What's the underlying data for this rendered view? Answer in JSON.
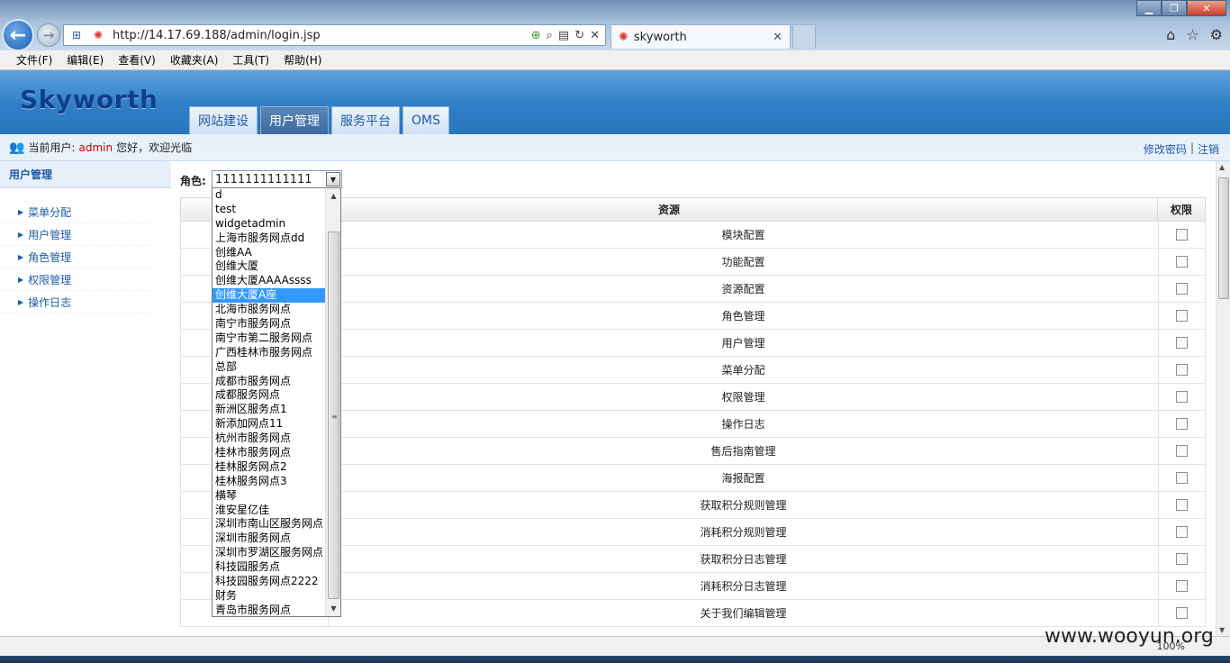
{
  "browser": {
    "url": "http://14.17.69.188/admin/login.jsp",
    "tab_title": "skyworth",
    "menu": [
      "文件(F)",
      "编辑(E)",
      "查看(V)",
      "收藏夹(A)",
      "工具(T)",
      "帮助(H)"
    ],
    "zoom": "100%"
  },
  "app": {
    "logo": "Skyworth",
    "nav_tabs": [
      "网站建设",
      "用户管理",
      "服务平台",
      "OMS"
    ],
    "active_tab": "用户管理"
  },
  "userbar": {
    "prefix": "当前用户:",
    "username": "admin",
    "greeting": "您好，欢迎光临",
    "change_password": "修改密码",
    "separator": "|",
    "logout": "注销"
  },
  "sidebar": {
    "title": "用户管理",
    "items": [
      "菜单分配",
      "用户管理",
      "角色管理",
      "权限管理",
      "操作日志"
    ]
  },
  "main": {
    "role_label": "角色:",
    "role_value": "1111111111111",
    "columns": {
      "resource": "资源",
      "permission": "权限"
    },
    "rows": [
      "模块配置",
      "功能配置",
      "资源配置",
      "角色管理",
      "用户管理",
      "菜单分配",
      "权限管理",
      "操作日志",
      "售后指南管理",
      "海报配置",
      "获取积分规则管理",
      "消耗积分规则管理",
      "获取积分日志管理",
      "消耗积分日志管理",
      "关于我们编辑管理"
    ]
  },
  "dropdown": {
    "selected": "创维大厦A座",
    "options": [
      "d",
      "test",
      "widgetadmin",
      "上海市服务网点dd",
      "创维AA",
      "创维大厦",
      "创维大厦AAAAssss",
      "创维大厦A座",
      "北海市服务网点",
      "南宁市服务网点",
      "南宁市第二服务网点",
      "广西桂林市服务网点",
      "总部",
      "成都市服务网点",
      "成都服务网点",
      "新洲区服务点1",
      "新添加网点11",
      "杭州市服务网点",
      "桂林市服务网点",
      "桂林服务网点2",
      "桂林服务网点3",
      "横琴",
      "淮安星亿佳",
      "深圳市南山区服务网点",
      "深圳市服务网点",
      "深圳市罗湖区服务网点",
      "科技园服务点",
      "科技园服务网点2222",
      "财务",
      "青岛市服务网点"
    ]
  },
  "watermark": "www.wooyun.org"
}
